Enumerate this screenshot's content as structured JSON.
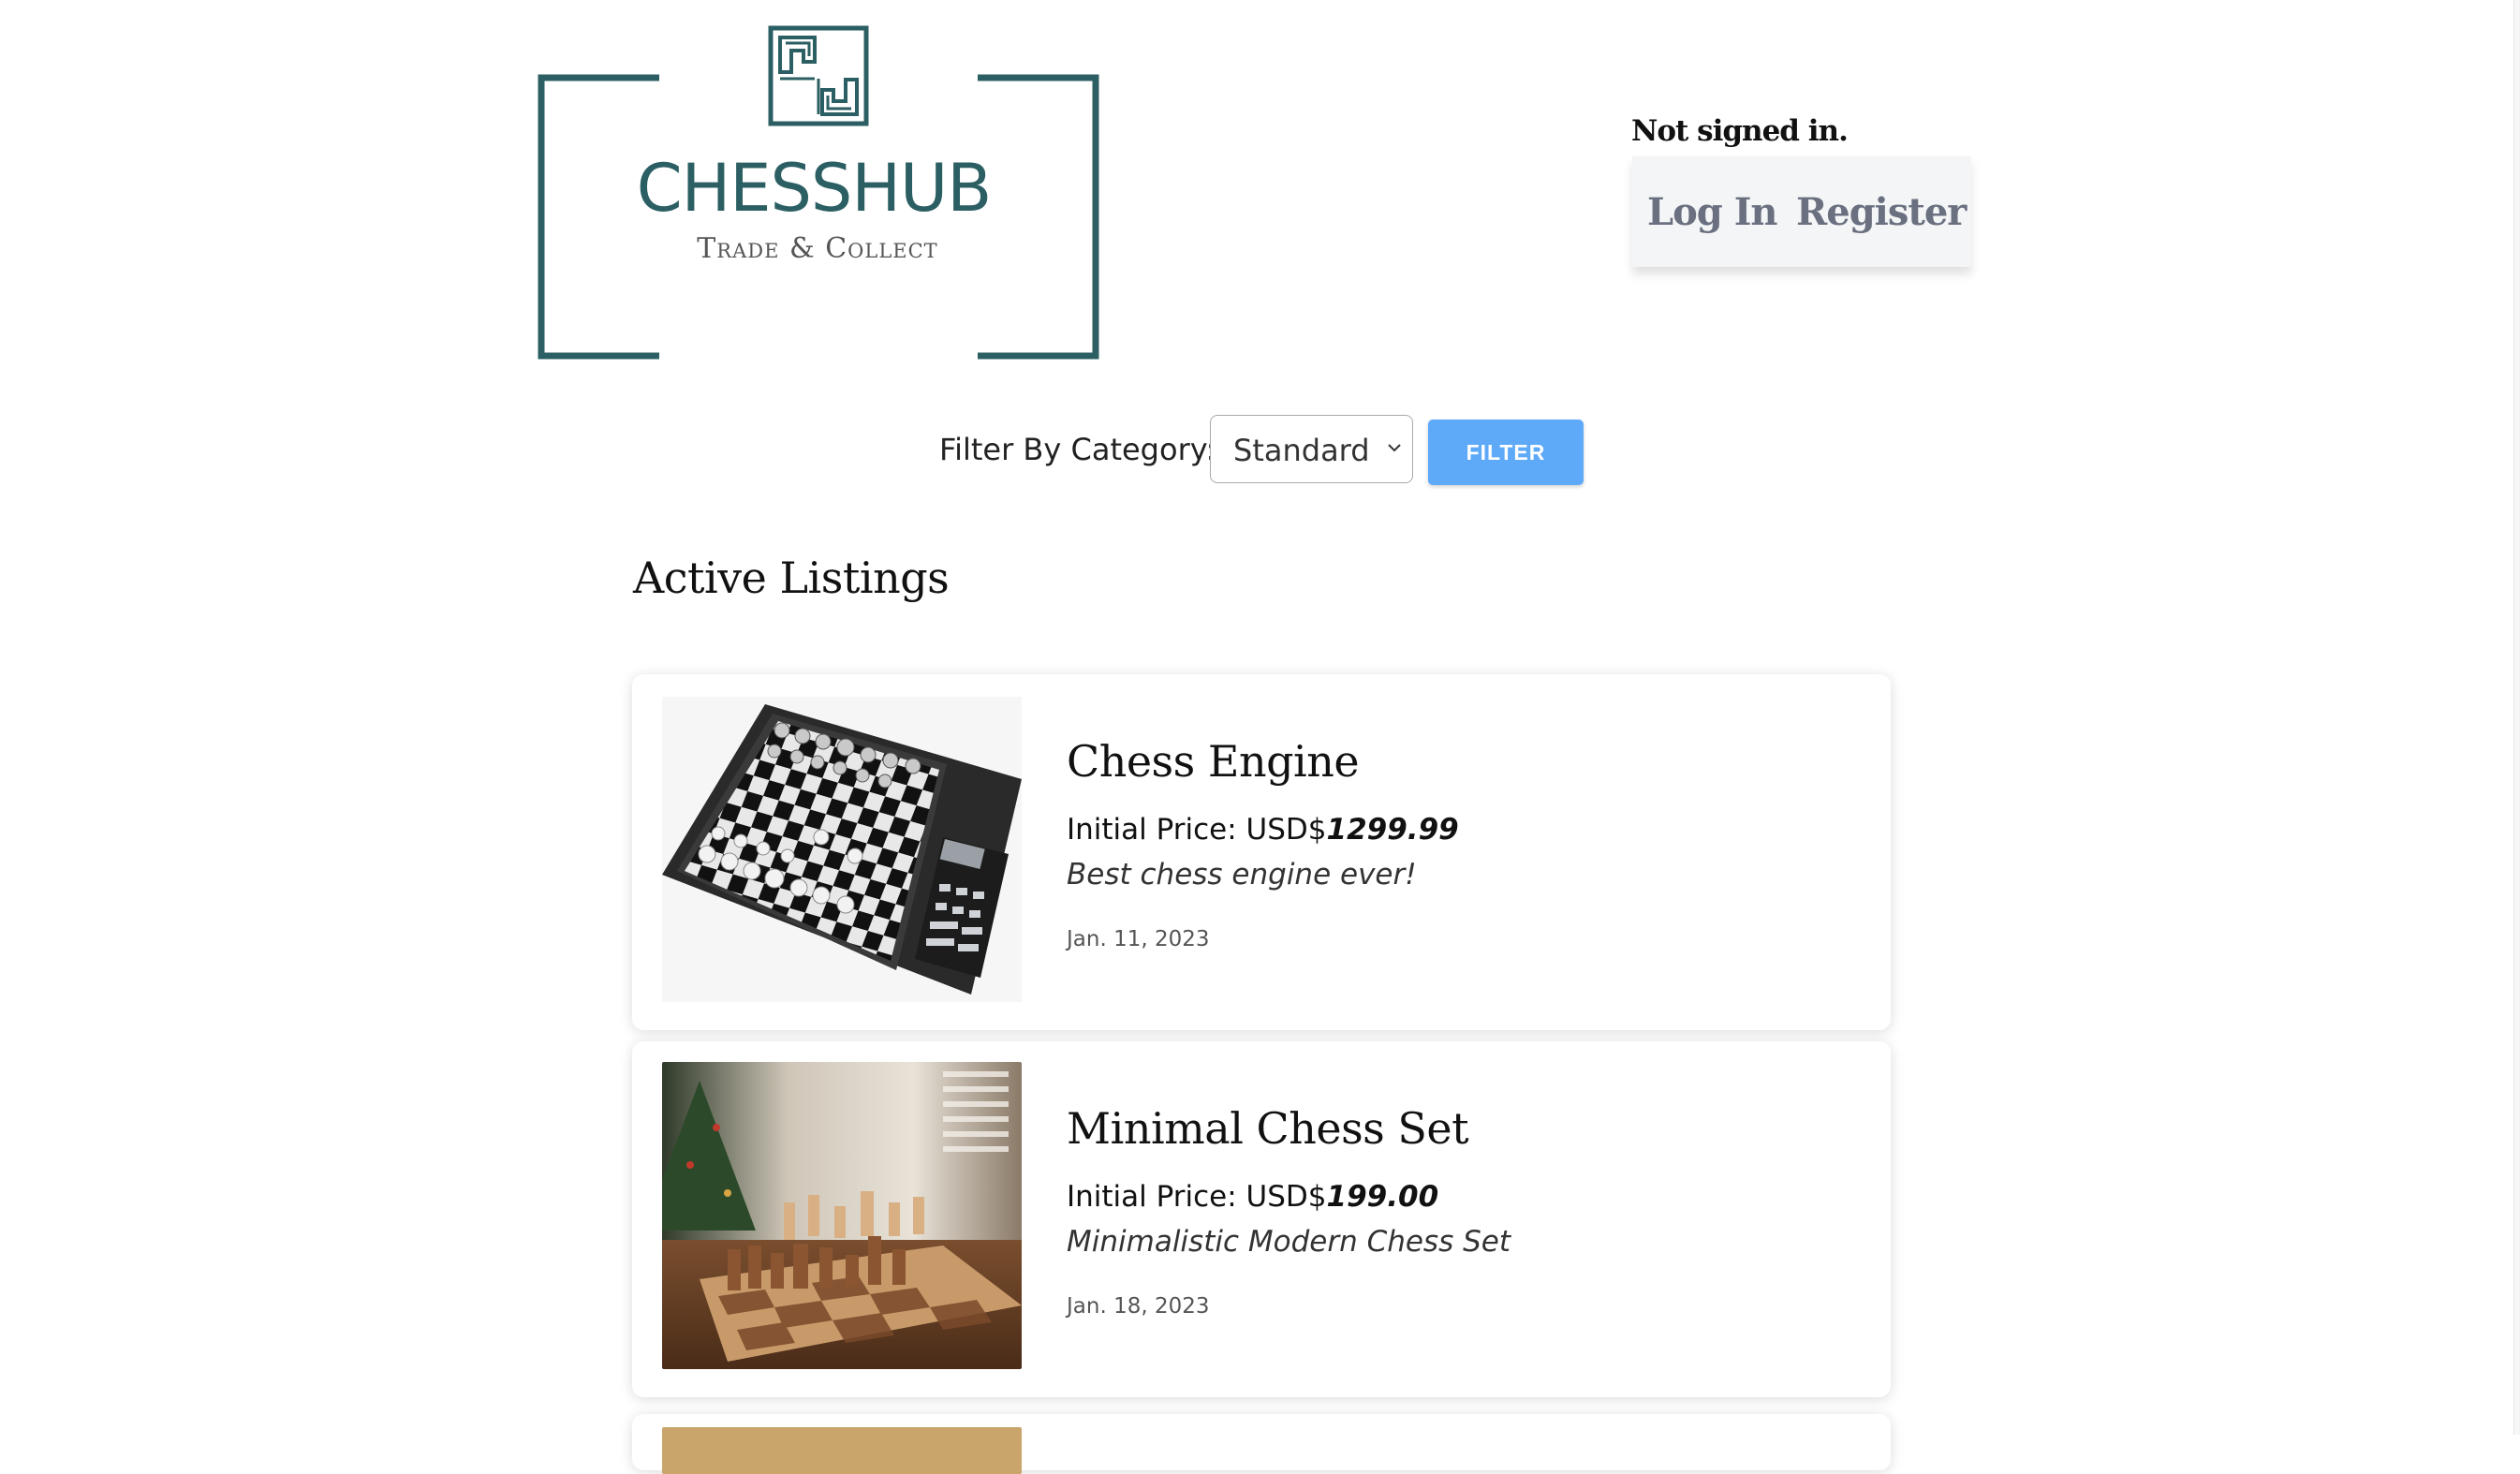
{
  "logo": {
    "name": "CHESSHUB",
    "tagline": "Trade & Collect",
    "color": "#2c5f63"
  },
  "auth": {
    "status": "Not signed in.",
    "login_label": "Log In",
    "register_label": "Register"
  },
  "filter": {
    "label": "Filter By Category:",
    "selected": "Standard",
    "button_label": "FILTER",
    "button_color": "#5ea9f8"
  },
  "listings_title": "Active Listings",
  "listings": [
    {
      "title": "Chess Engine",
      "price_prefix": "Initial Price: USD$",
      "price": "1299.99",
      "description": "Best chess engine ever!",
      "date": "Jan. 11, 2023"
    },
    {
      "title": "Minimal Chess Set",
      "price_prefix": "Initial Price: USD$",
      "price": "199.00",
      "description": "Minimalistic Modern Chess Set",
      "date": "Jan. 18, 2023"
    }
  ]
}
